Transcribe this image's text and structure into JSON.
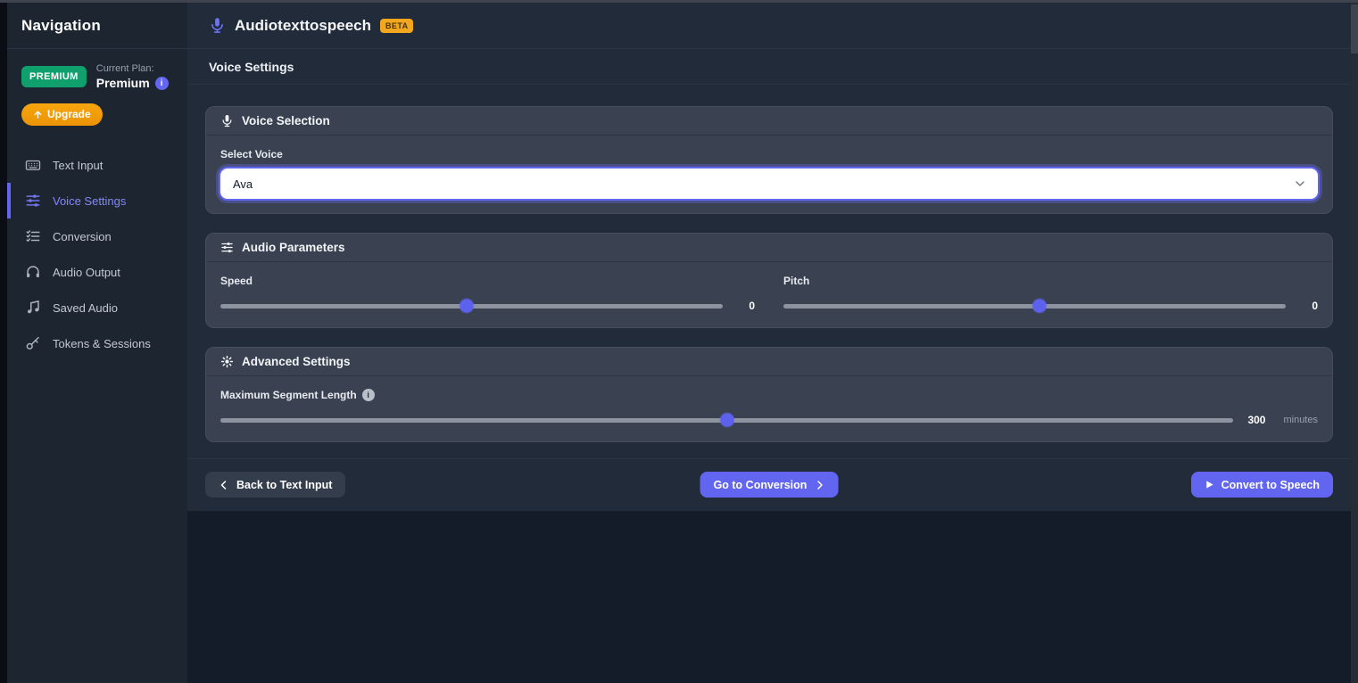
{
  "sidebar": {
    "title": "Navigation",
    "plan": {
      "badge": "PREMIUM",
      "current_plan_label": "Current Plan:",
      "plan_name": "Premium",
      "info_glyph": "i"
    },
    "upgrade_label": "Upgrade",
    "items": [
      {
        "label": "Text Input",
        "icon": "keyboard-icon",
        "active": false
      },
      {
        "label": "Voice Settings",
        "icon": "sliders-icon",
        "active": true
      },
      {
        "label": "Conversion",
        "icon": "checklist-icon",
        "active": false
      },
      {
        "label": "Audio Output",
        "icon": "headphones-icon",
        "active": false
      },
      {
        "label": "Saved Audio",
        "icon": "music-note-icon",
        "active": false
      },
      {
        "label": "Tokens & Sessions",
        "icon": "key-icon",
        "active": false
      }
    ]
  },
  "header": {
    "app_title": "Audiotexttospeech",
    "beta_badge": "BETA",
    "page_title": "Voice Settings"
  },
  "voice_selection": {
    "card_title": "Voice Selection",
    "select_label": "Select Voice",
    "selected_voice": "Ava"
  },
  "audio_parameters": {
    "card_title": "Audio Parameters",
    "speed": {
      "label": "Speed",
      "value": "0",
      "position_percent": 49
    },
    "pitch": {
      "label": "Pitch",
      "value": "0",
      "position_percent": 51
    }
  },
  "advanced_settings": {
    "card_title": "Advanced Settings",
    "max_segment_length": {
      "label": "Maximum Segment Length",
      "info_glyph": "i",
      "value": "300",
      "unit": "minutes",
      "position_percent": 50
    }
  },
  "footer": {
    "back_button": "Back to Text Input",
    "conversion_button": "Go to Conversion",
    "convert_button": "Convert to Speech"
  },
  "colors": {
    "accent": "#6366f1",
    "accent_active": "#818cf8",
    "premium_green": "#0fa06d",
    "upgrade_orange": "#f09c0b",
    "beta_amber": "#f2a71e"
  }
}
